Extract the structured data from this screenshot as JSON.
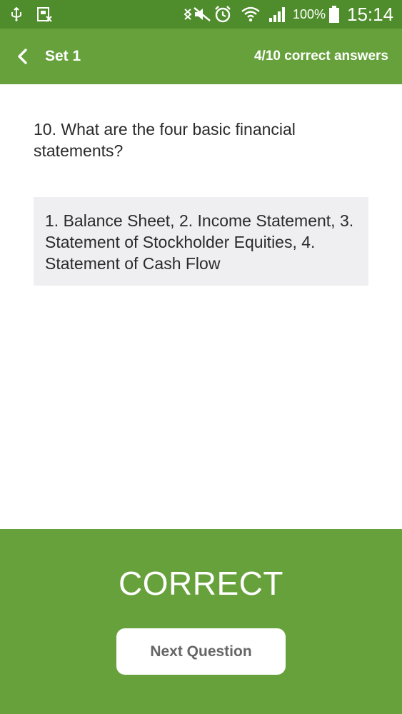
{
  "status_bar": {
    "battery_percent": "100%",
    "time": "15:14",
    "icons": [
      "usb-icon",
      "sim-toolkit-icon",
      "nfc-icon",
      "mute-icon",
      "alarm-icon",
      "wifi-icon",
      "signal-icon",
      "battery-icon"
    ]
  },
  "header": {
    "title": "Set 1",
    "score": "4/10 correct answers",
    "back_icon": "chevron-left-icon"
  },
  "question": {
    "text": "10. What are the four basic financial statements?"
  },
  "answer": {
    "text": "1. Balance Sheet, 2. Income Statement, 3. Statement of Stockholder Equities, 4. Statement of Cash Flow"
  },
  "result": {
    "label": "CORRECT",
    "next_button_label": "Next Question"
  },
  "colors": {
    "status_bar": "#4f8d2c",
    "primary_green": "#67a13b",
    "answer_background": "#efeff2",
    "text_dark": "#2a2a2a",
    "button_text": "#666666"
  }
}
